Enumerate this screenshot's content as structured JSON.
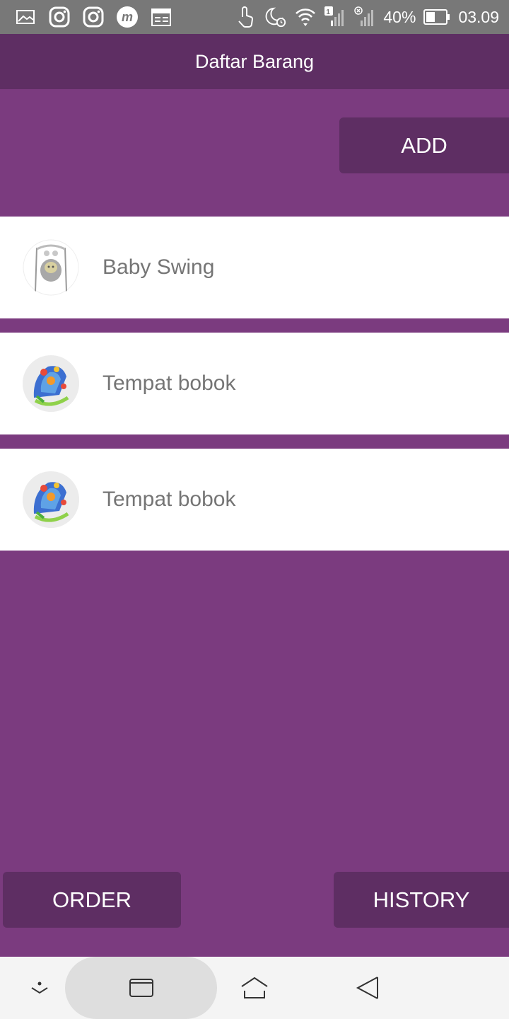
{
  "status_bar": {
    "battery_percent": "40%",
    "time": "03.09",
    "sim_badge": "1",
    "left_icons": [
      "gallery-icon",
      "instagram-icon",
      "instagram-icon",
      "m-app-icon",
      "calendar-icon"
    ],
    "right_icons": [
      "touch-icon",
      "moon-alarm-icon",
      "wifi-icon",
      "signal-icon",
      "signal-off-icon",
      "battery-icon"
    ]
  },
  "app_bar": {
    "title": "Daftar Barang"
  },
  "actions": {
    "add_label": "ADD",
    "order_label": "ORDER",
    "history_label": "HISTORY"
  },
  "items": [
    {
      "name": "Baby Swing",
      "thumb_icon": "baby-swing-image"
    },
    {
      "name": "Tempat bobok",
      "thumb_icon": "baby-bouncer-image"
    },
    {
      "name": "Tempat bobok",
      "thumb_icon": "baby-bouncer-image"
    }
  ],
  "nav_bar": {
    "icons": [
      "collapse-icon",
      "recent-apps-icon",
      "home-icon",
      "back-icon"
    ]
  },
  "colors": {
    "primary": "#7b3b7f",
    "primary_dark": "#5e2e63",
    "status_bar": "#787878"
  }
}
